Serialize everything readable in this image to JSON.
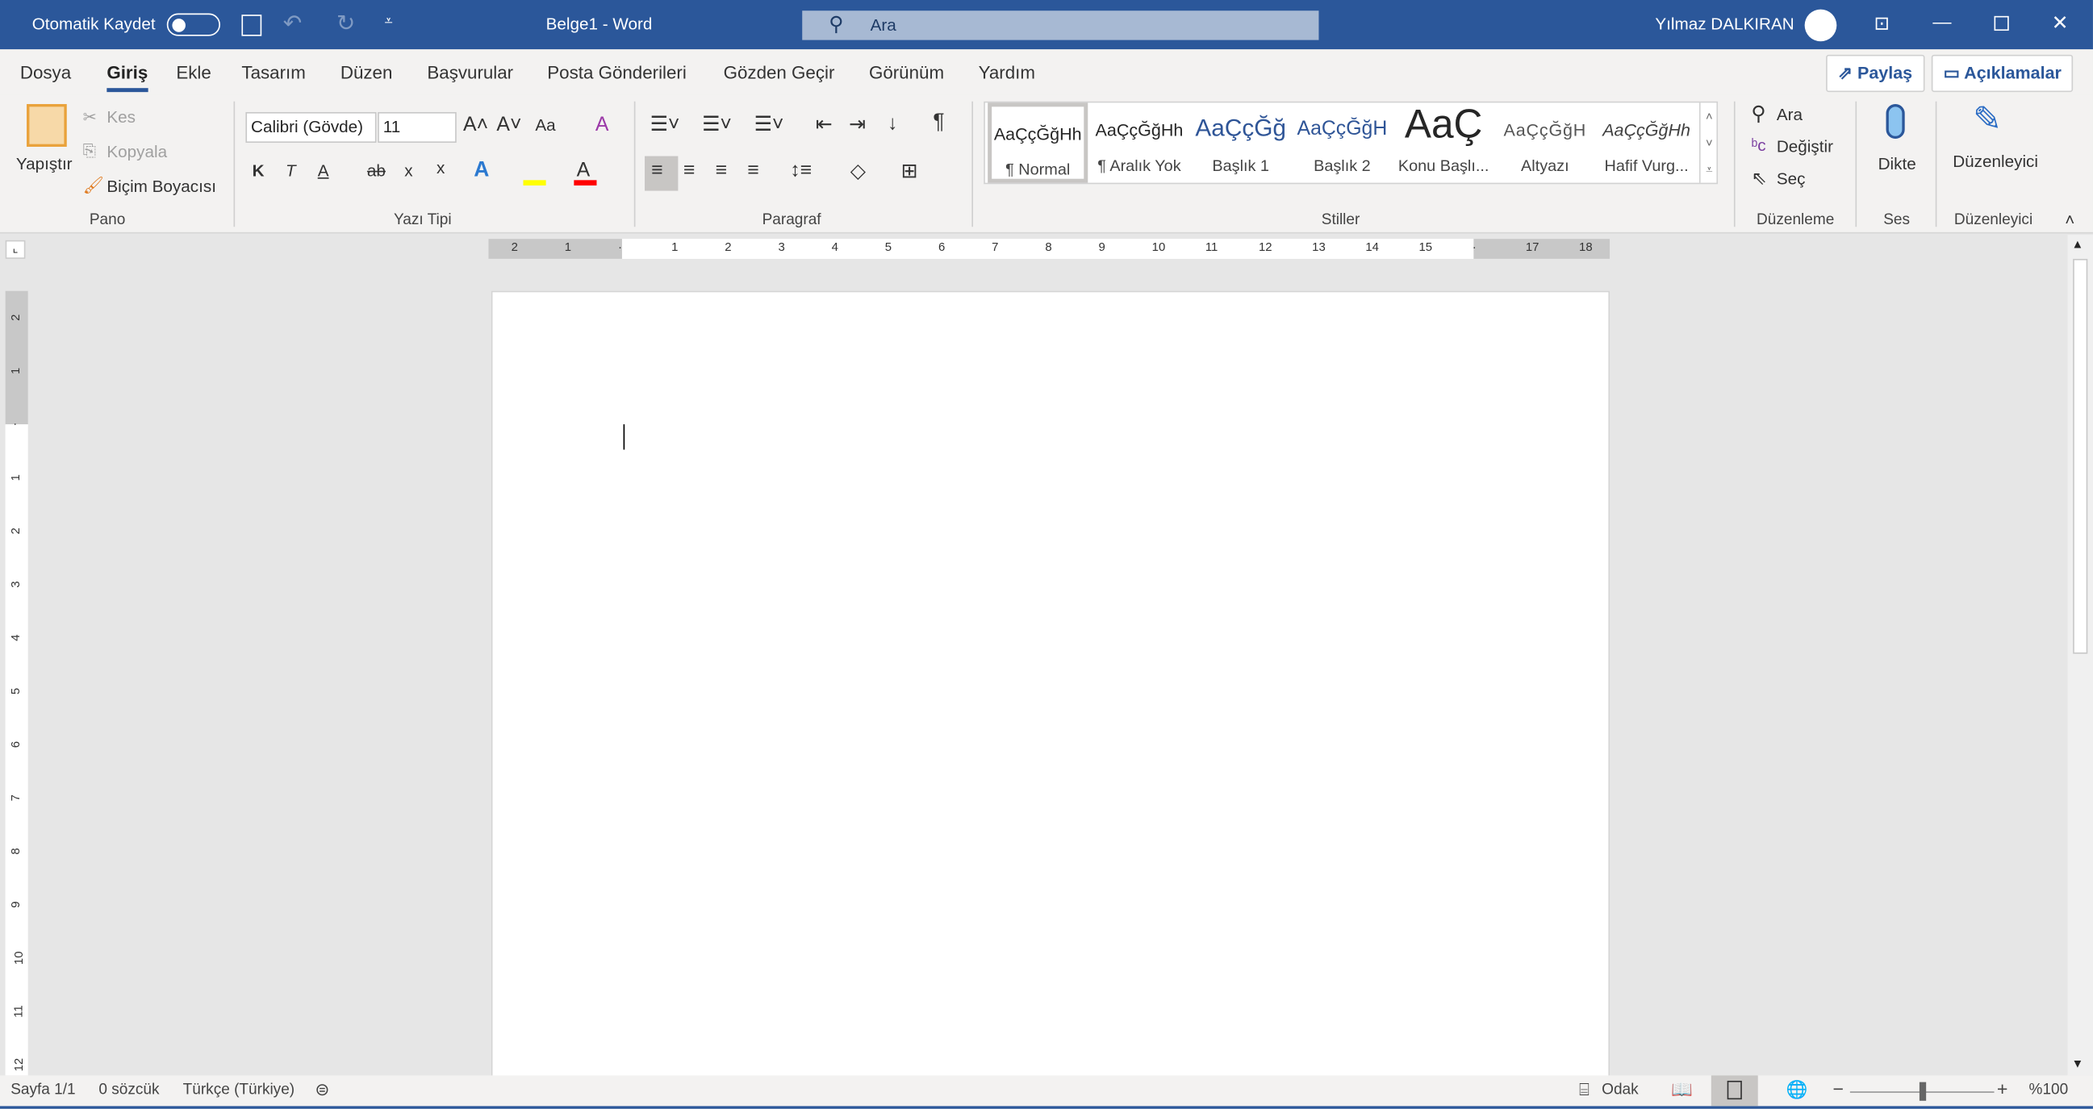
{
  "titlebar": {
    "autosave_label": "Otomatik Kaydet",
    "autosave_on": false,
    "doc_title": "Belge1  -  Word",
    "search_placeholder": "Ara",
    "user": "Yılmaz DALKIRAN",
    "accent": "#2b579a"
  },
  "tabs": [
    "Dosya",
    "Giriş",
    "Ekle",
    "Tasarım",
    "Düzen",
    "Başvurular",
    "Posta Gönderileri",
    "Gözden Geçir",
    "Görünüm",
    "Yardım"
  ],
  "selected_tab": "Giriş",
  "share": "Paylaş",
  "comments": "Açıklamalar",
  "clipboard": {
    "paste": "Yapıştır",
    "cut": "Kes",
    "copy": "Kopyala",
    "painter": "Biçim Boyacısı",
    "group": "Pano"
  },
  "font": {
    "name": "Calibri (Gövde)",
    "size": "11",
    "case": "Aa",
    "bold": "K",
    "italic": "T",
    "underline": "A",
    "strike": "ab",
    "sub": "x",
    "sup": "x",
    "group": "Yazı Tipi"
  },
  "paragraph": {
    "group": "Paragraf"
  },
  "styles": {
    "group": "Stiller",
    "items": [
      {
        "preview": "AaÇçĞğHh",
        "name": "¶ Normal"
      },
      {
        "preview": "AaÇçĞğHh",
        "name": "¶ Aralık Yok"
      },
      {
        "preview": "AaÇçĞğ",
        "name": "Başlık 1"
      },
      {
        "preview": "AaÇçĞğH",
        "name": "Başlık 2"
      },
      {
        "preview": "AaÇ",
        "name": "Konu Başlı..."
      },
      {
        "preview": "AaÇçĞğH",
        "name": "Altyazı"
      },
      {
        "preview": "AaÇçĞğHh",
        "name": "Hafif Vurg..."
      }
    ]
  },
  "editing": {
    "find": "Ara",
    "replace": "Değiştir",
    "select": "Seç",
    "group": "Düzenleme"
  },
  "voice": {
    "dictate": "Dikte",
    "group": "Ses"
  },
  "editor": {
    "label": "Düzenleyici",
    "group": "Düzenleyici"
  },
  "ruler": {
    "h": [
      "2",
      "1",
      "",
      "1",
      "2",
      "3",
      "4",
      "5",
      "6",
      "7",
      "8",
      "9",
      "10",
      "11",
      "12",
      "13",
      "14",
      "15",
      "",
      "17",
      "18"
    ],
    "v": [
      "2",
      "1",
      "",
      "1",
      "2",
      "3",
      "4",
      "5",
      "6",
      "7",
      "8",
      "9",
      "10",
      "11",
      "12"
    ]
  },
  "status": {
    "page": "Sayfa 1/1",
    "words": "0 sözcük",
    "lang": "Türkçe (Türkiye)",
    "focus": "Odak",
    "zoom": "%100",
    "zoom_level": 100
  }
}
